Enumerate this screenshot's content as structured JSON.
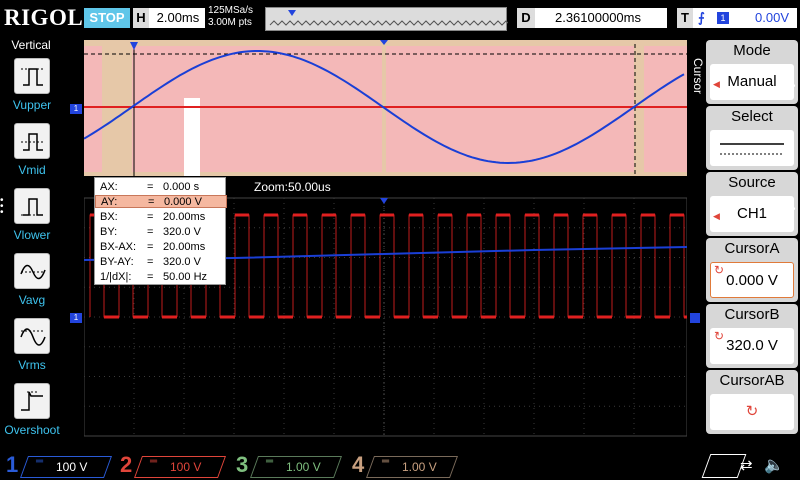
{
  "topbar": {
    "brand": "RIGOL",
    "status": "STOP",
    "h_key": "H",
    "timebase": "2.00ms",
    "sample_rate": "125MSa/s",
    "mem_depth": "3.00M pts",
    "d_key": "D",
    "delay": "2.36100000ms",
    "t_key": "T",
    "trigger_edge": "⨍",
    "trigger_source": "1",
    "trigger_level": "0.00V"
  },
  "leftbar": {
    "title": "Vertical",
    "items": [
      {
        "label": "Vupper",
        "icon": "vupper-icon"
      },
      {
        "label": "Vmid",
        "icon": "vmid-icon"
      },
      {
        "label": "Vlower",
        "icon": "vlower-icon"
      },
      {
        "label": "Vavg",
        "icon": "vavg-icon"
      },
      {
        "label": "Vrms",
        "icon": "vrms-icon"
      },
      {
        "label": "Overshoot",
        "icon": "overshoot-icon"
      }
    ]
  },
  "readout": [
    {
      "key": "AX:",
      "value": "0.000 s"
    },
    {
      "key": "AY:",
      "value": "0.000 V"
    },
    {
      "key": "BX:",
      "value": "20.00ms"
    },
    {
      "key": "BY:",
      "value": "320.0 V"
    },
    {
      "key": "BX-AX:",
      "value": "20.00ms"
    },
    {
      "key": "BY-AY:",
      "value": "320.0 V"
    },
    {
      "key": "1/|dX|:",
      "value": "50.00 Hz"
    }
  ],
  "readout_eq": "=",
  "zoom": "Zoom:50.00us",
  "channel_marker": "1",
  "rightpanel": {
    "side_label": "Cursor",
    "mode": {
      "label": "Mode",
      "value": "Manual"
    },
    "select": {
      "label": "Select"
    },
    "source": {
      "label": "Source",
      "value": "CH1"
    },
    "cursor_a": {
      "label": "CursorA",
      "value": "0.000 V"
    },
    "cursor_b": {
      "label": "CursorB",
      "value": "320.0 V"
    },
    "cursor_ab": {
      "label": "CursorAB"
    }
  },
  "bottombar": {
    "channels": [
      {
        "num": "1",
        "coupling": "═",
        "scale": "100 V",
        "color": "#2a5bd7"
      },
      {
        "num": "2",
        "coupling": "═",
        "scale": "100 V",
        "color": "#e0453a"
      },
      {
        "num": "3",
        "coupling": "═",
        "scale": "1.00 V",
        "color": "#7fbf7f"
      },
      {
        "num": "4",
        "coupling": "═",
        "scale": "1.00 V",
        "color": "#c8a080"
      }
    ]
  },
  "colors": {
    "ch1_trace": "#1a3fd6",
    "ch2_trace": "#e02020",
    "accent": "#5fc6e9",
    "overview_bg": "#e6c8a8",
    "overview_band": "#f4b8b8"
  }
}
